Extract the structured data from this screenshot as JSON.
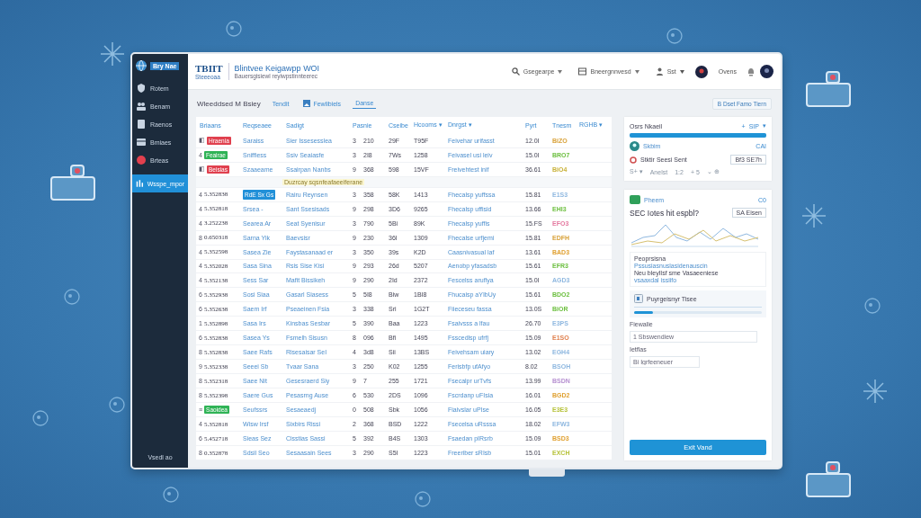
{
  "header": {
    "logo": "TBIIT",
    "logo_sub": "Steeeoaa",
    "title": "Blintvee Keigawpp WOI",
    "subtitle": "Bauersgisiewl reyiwpstinnteerec",
    "menus": [
      "Gsegearpe",
      "Bneergnnvesd"
    ],
    "user_menu": "Sst",
    "user_name": "Ovens"
  },
  "sidebar": {
    "brand": "Bry Nae",
    "items": [
      {
        "label": "Rotem",
        "selected": false
      },
      {
        "label": "Benam",
        "selected": false
      },
      {
        "label": "Raenos",
        "selected": false
      },
      {
        "label": "Bmiaes",
        "selected": false
      },
      {
        "label": "Brteas",
        "selected": false
      },
      {
        "label": "Wsspe_mpor",
        "selected": true
      }
    ],
    "footer": "Vsedl ao"
  },
  "toolbar": {
    "title": "Wleeddsed M Bsiey",
    "tabs": [
      {
        "label": "Tendit",
        "selected": false
      },
      {
        "label": "Fewlibiels",
        "selected": false
      },
      {
        "label": "Danse",
        "selected": true
      }
    ],
    "action": "B Dset Famo Tiern"
  },
  "table": {
    "columns": [
      "Briaans",
      "Reqseaee",
      "Sadigt",
      "Pasnie",
      "Cseibe",
      "Hcooms ▾",
      "Dnrgst ▾",
      "Pyrt",
      "Tnesm",
      "RGHB ▾"
    ],
    "rows": [
      {
        "kind": "tagged",
        "lead": "◧",
        "first": "Hraenia",
        "color": "#e0404e",
        "name_highlight": false,
        "cells": [
          "Saraiss",
          "Sier Issesesslea",
          "3",
          "210",
          "29F",
          "T95F",
          "Feivehar urifasst",
          "12.0I"
        ],
        "status": {
          "text": "BiZO",
          "color": "#d9a23a"
        }
      },
      {
        "kind": "tagged",
        "lead": "4",
        "first": "Feairae",
        "color": "#2fb356",
        "name_highlight": false,
        "cells": [
          "Sniffiess",
          "Ssiv Seaiasfe",
          "3",
          "2I8",
          "7Ws",
          "1258",
          "Feivasel usi leiv",
          "15.0I"
        ],
        "status": {
          "text": "BRO7",
          "color": "#6cbf3f"
        }
      },
      {
        "kind": "tagged",
        "lead": "◧",
        "first": "Beisias",
        "color": "#e0404e",
        "name_highlight": false,
        "cells": [
          "Szaaeame",
          "Ssairpan Nanbs",
          "9",
          "368",
          "598",
          "15VF",
          "Freivehtest inif",
          "36.61"
        ],
        "status": {
          "text": "BiO4",
          "color": "#c9b23a"
        }
      },
      {
        "kind": "note",
        "text": "Duzrcay sqsnfeafaeeiferane"
      },
      {
        "kind": "plain",
        "lead": "4",
        "first": "5.352838",
        "name_highlight": true,
        "cells": [
          "RdE Sx Gs",
          "Rairu Reynsen",
          "3",
          "358",
          "58K",
          "1413",
          "Fhecalsp yuffssa",
          "15.81"
        ],
        "status": {
          "text": "E1S3",
          "color": "#8fb8e0"
        }
      },
      {
        "kind": "plain",
        "lead": "4",
        "first": "5.352818",
        "name_highlight": false,
        "cells": [
          "Srsea -",
          "Sant Ssesisads",
          "9",
          "298",
          "3D6",
          "9265",
          "Fhecalsp uffisid",
          "13.66"
        ],
        "status": {
          "text": "EHI3",
          "color": "#6cbf3f"
        }
      },
      {
        "kind": "plain",
        "lead": "4",
        "first": "3.252238",
        "name_highlight": false,
        "cells": [
          "Searea Ar",
          "Seat Syenisur",
          "3",
          "790",
          "5Bi",
          "89K",
          "Fhecalsp yuffis",
          "15.FS"
        ],
        "status": {
          "text": "EFO3",
          "color": "#e47aa0"
        }
      },
      {
        "kind": "plain",
        "lead": "8",
        "first": "0.650318",
        "name_highlight": false,
        "cells": [
          "Sarna Yik",
          "Baevsisr",
          "9",
          "230",
          "36I",
          "1309",
          "Fhecalse urfjemi",
          "15.81"
        ],
        "status": {
          "text": "EDFH",
          "color": "#d9a23a"
        }
      },
      {
        "kind": "plain",
        "lead": "4",
        "first": "5.352598",
        "name_highlight": false,
        "cells": [
          "Sasea Zie",
          "Faystasanaad er",
          "3",
          "350",
          "39s",
          "K2D",
          "Caasnivasual laf",
          "13.61"
        ],
        "status": {
          "text": "BAD3",
          "color": "#e0a030"
        }
      },
      {
        "kind": "plain",
        "lead": "4",
        "first": "5.352028",
        "name_highlight": false,
        "cells": [
          "Sasa Sina",
          "Rsis Sise Kisi",
          "9",
          "293",
          "26d",
          "5207",
          "Aenobp yfasadsb",
          "15.61"
        ],
        "status": {
          "text": "EFR3",
          "color": "#6cbf3f"
        }
      },
      {
        "kind": "plain",
        "lead": "4",
        "first": "5.352138",
        "name_highlight": false,
        "cells": [
          "Sess Sar",
          "Mafit Bissikeh",
          "9",
          "290",
          "2Id",
          "2372",
          "Fescelss aruflya",
          "15.0I"
        ],
        "status": {
          "text": "AGD3",
          "color": "#8fb8e0"
        }
      },
      {
        "kind": "plain",
        "lead": "6",
        "first": "5.352938",
        "name_highlight": false,
        "cells": [
          "Sosi Siaa",
          "Gasarl Siasess",
          "5",
          "5I8",
          "Biw",
          "1BI8",
          "Fhucaisp aYIbUy",
          "15.61"
        ],
        "status": {
          "text": "BDO2",
          "color": "#6cbf3f"
        }
      },
      {
        "kind": "plain",
        "lead": "6",
        "first": "5.352638",
        "name_highlight": false,
        "cells": [
          "Saem Irf",
          "Pseaeinen Fsia",
          "3",
          "338",
          "Sri",
          "1G2T",
          "Fiieceseu fassa",
          "13.0S"
        ],
        "status": {
          "text": "BiOR",
          "color": "#6cbf3f"
        }
      },
      {
        "kind": "plain",
        "lead": "1",
        "first": "5.352898",
        "name_highlight": false,
        "cells": [
          "Sasa Irs",
          "Kinsbas Sesbar",
          "5",
          "390",
          "Baa",
          "1223",
          "Fsaivsss a lfau",
          "26.70"
        ],
        "status": {
          "text": "E3PS",
          "color": "#8fb8e0"
        }
      },
      {
        "kind": "plain",
        "lead": "6",
        "first": "5.352838",
        "name_highlight": false,
        "cells": [
          "Sasea Ys",
          "Fsmelh Sisusn",
          "8",
          "096",
          "Bfi",
          "1495",
          "Fsscedlsp ufrfj",
          "15.09"
        ],
        "status": {
          "text": "E1SO",
          "color": "#e0804e"
        }
      },
      {
        "kind": "plain",
        "lead": "8",
        "first": "5.352838",
        "name_highlight": false,
        "cells": [
          "Saee Rafs",
          "Risesaisar SeI",
          "4",
          "3d8",
          "Sii",
          "13BS",
          "Feivehsam uiary",
          "13.02"
        ],
        "status": {
          "text": "EGH4",
          "color": "#8fb8e0"
        }
      },
      {
        "kind": "plain",
        "lead": "9",
        "first": "5.352338",
        "name_highlight": false,
        "cells": [
          "Seeei Sb",
          "Tvaar Sana",
          "3",
          "250",
          "K02",
          "1255",
          "Ferisbfp ufAfyo",
          "8.02"
        ],
        "status": {
          "text": "BSOH",
          "color": "#8fb8e0"
        }
      },
      {
        "kind": "plain",
        "lead": "8",
        "first": "5.352318",
        "name_highlight": false,
        "cells": [
          "Saee Nit",
          "Gesesraerd Siy",
          "9",
          "7",
          "255",
          "1721",
          "Fsecalpr urTvfs",
          "13.99"
        ],
        "status": {
          "text": "BSDN",
          "color": "#b58fd0"
        }
      },
      {
        "kind": "plain",
        "lead": "8",
        "first": "5.352398",
        "name_highlight": false,
        "cells": [
          "Saere Gus",
          "Pesasrng Ause",
          "6",
          "530",
          "2DS",
          "1096",
          "Fscrdanp uFIsia",
          "16.01"
        ],
        "status": {
          "text": "BGD2",
          "color": "#e0a030"
        }
      },
      {
        "kind": "tagged",
        "lead": "≡",
        "first": "Saoidea",
        "color": "#2fb356",
        "name_highlight": false,
        "cells": [
          "Seufssrs",
          "Sesaeaedj",
          "0",
          "508",
          "Sbk",
          "1056",
          "Fiaivslar uPIse",
          "16.05"
        ],
        "status": {
          "text": "E3E3",
          "color": "#b6c23a"
        }
      },
      {
        "kind": "plain",
        "lead": "4",
        "first": "5.352818",
        "name_highlight": false,
        "cells": [
          "Wisw Irsf",
          "Sixbirs Rissi",
          "2",
          "368",
          "BSD",
          "1222",
          "Fsecelsa uRsssa",
          "18.02"
        ],
        "status": {
          "text": "EFW3",
          "color": "#8fb8e0"
        }
      },
      {
        "kind": "plain",
        "lead": "6",
        "first": "5.452718",
        "name_highlight": false,
        "cells": [
          "Sieas Sez",
          "Cisstias Sassi",
          "5",
          "392",
          "B4S",
          "1303",
          "Fsaedan pIRsrb",
          "15.09"
        ],
        "status": {
          "text": "BSD3",
          "color": "#e0a030"
        }
      },
      {
        "kind": "plain",
        "lead": "8",
        "first": "0.352878",
        "name_highlight": false,
        "cells": [
          "Sdsil Seo",
          "Sesaasain Sees",
          "3",
          "290",
          "S5I",
          "1223",
          "Freeriber sRIsb",
          "15.01"
        ],
        "status": {
          "text": "EXCH",
          "color": "#b6c23a"
        }
      }
    ]
  },
  "panel": {
    "card1": {
      "title": "Osrs Nkaeil",
      "actions": [
        "+",
        "SIP",
        "▾"
      ],
      "progress": {
        "level": 1
      },
      "sub_label": "Skbim",
      "sub_action": "CAI",
      "line": "Stktir Seesi Sent",
      "field": "Bf3 SE7h",
      "controls": [
        "S+ ▾",
        "Anelst",
        "1:2",
        "+ 5",
        "⌄ ⊕"
      ]
    },
    "card2": {
      "label": "Pheem",
      "action": "C0",
      "headline": "SEC Iotes hit espbl?",
      "badge": "SA Eisen",
      "note_title": "Peoprsisna",
      "note_link": "Pssusiasnuslasidenauscin",
      "note_text": "Neu bleylIsf sme Vasaeeniese",
      "note_link2": "vsaaxdal issiifo",
      "task": "Puyrgeisnyr Tisee",
      "task_progress": {
        "level": 0.15
      },
      "field1_label": "Fiewalie",
      "field1": "1 Sbswendiew",
      "field2_label": "Ietflas",
      "field2": "Bi Igrfeeneuer",
      "button": "Exit Vand"
    }
  }
}
